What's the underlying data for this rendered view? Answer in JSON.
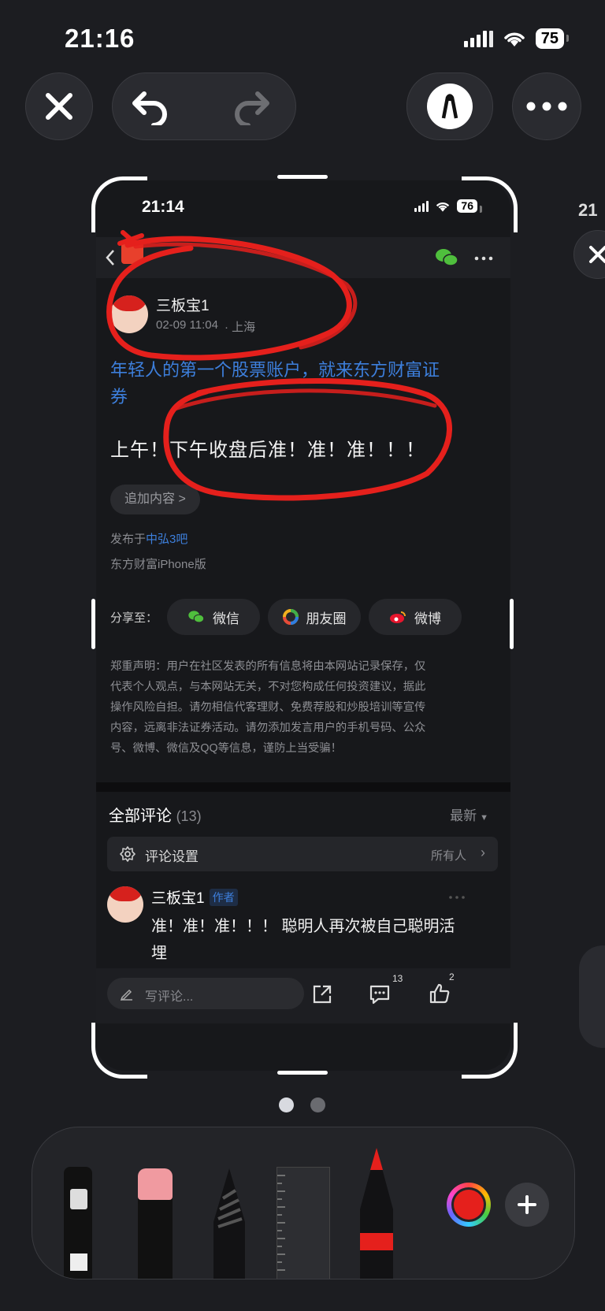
{
  "status_bar": {
    "time": "21:16",
    "battery": "75"
  },
  "inner_status": {
    "time": "21:14",
    "battery": "76"
  },
  "post": {
    "author": "三板宝1",
    "meta_time": "02-09 11:04",
    "meta_location": "· 上海",
    "promo_line1": "年轻人的第一个股票账户，就来东方财富证",
    "promo_line2": "券",
    "body": "上午！下午收盘后准！准！准！！！",
    "append_button": "追加内容 >",
    "published_prefix": "发布于",
    "forum": "中弘3吧",
    "client": "东方财富iPhone版"
  },
  "share": {
    "label": "分享至：",
    "wechat": "微信",
    "moments": "朋友圈",
    "weibo": "微博"
  },
  "disclaimer": {
    "lines": [
      "郑重声明：用户在社区发表的所有信息将由本网站记录保存，仅",
      "代表个人观点，与本网站无关，不对您构成任何投资建议，据此",
      "操作风险自担。请勿相信代客理财、免费荐股和炒股培训等宣传",
      "内容，远离非法证券活动。请勿添加发言用户的手机号码、公众",
      "号、微博、微信及QQ等信息，谨防上当受骗！"
    ]
  },
  "comments": {
    "title": "全部评论",
    "count": "(13)",
    "sort": "最新",
    "settings_label": "评论设置",
    "settings_value": "所有人",
    "first": {
      "author": "三板宝1",
      "badge": "作者",
      "line1": "准！准！准！！！ 聪明人再次被自己聪明活",
      "line2": "埋"
    }
  },
  "bottom_bar": {
    "placeholder": "写评论...",
    "comment_count": "13",
    "like_count": "2"
  },
  "colors": {
    "accent_blue": "#3d7fdc",
    "annotation_red": "#e5201c",
    "color_picker": "#e5201c"
  },
  "icons": [
    "close-icon",
    "undo-icon",
    "redo-icon",
    "markup-pen-icon",
    "more-icon",
    "wechat-icon",
    "share-icon",
    "comment-icon",
    "like-icon",
    "gear-icon",
    "add-icon"
  ]
}
